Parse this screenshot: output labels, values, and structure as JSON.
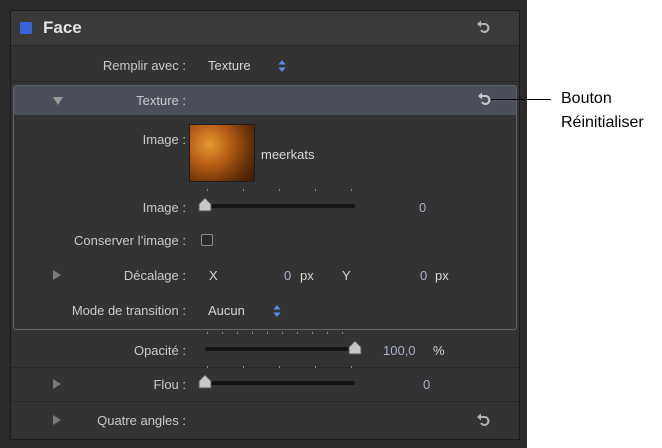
{
  "header": {
    "title": "Face"
  },
  "fill": {
    "label": "Remplir avec :",
    "value": "Texture"
  },
  "texture": {
    "header_label": "Texture :",
    "image_label": "Image :",
    "image_name": "meerkats",
    "frame_label": "Image :",
    "frame_value": "0",
    "frame_level": 0,
    "hold_label": "Conserver l’image :",
    "hold_checked": false,
    "offset_label": "Décalage :",
    "offset_x_label": "X",
    "offset_x_value": "0",
    "offset_x_unit": "px",
    "offset_y_label": "Y",
    "offset_y_value": "0",
    "offset_y_unit": "px",
    "wrap_label": "Mode de transition :",
    "wrap_value": "Aucun"
  },
  "opacity": {
    "label": "Opacité :",
    "value": "100,0",
    "unit": "%",
    "level": 1.0
  },
  "blur": {
    "label": "Flou :",
    "value": "0",
    "level": 0
  },
  "four_corners": {
    "label": "Quatre angles :"
  },
  "callout": {
    "line1": "Bouton",
    "line2": "Réinitialiser"
  },
  "colors": {
    "accent": "#3b63d9",
    "panel": "#333334",
    "highlight": "#4a4f5b"
  }
}
